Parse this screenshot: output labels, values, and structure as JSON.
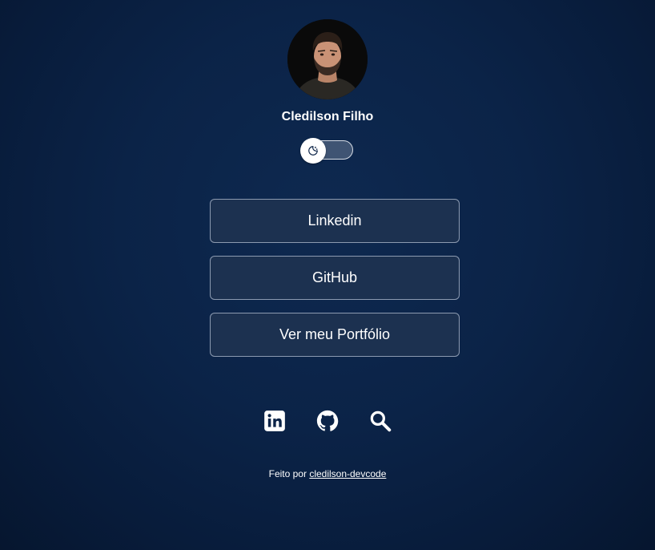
{
  "profile": {
    "name": "Cledilson Filho"
  },
  "theme_toggle": {
    "icon": "moon-sun-icon",
    "track_color": "#3f5473"
  },
  "links": [
    {
      "label": "Linkedin"
    },
    {
      "label": "GitHub"
    },
    {
      "label": "Ver meu Portfólio"
    }
  ],
  "socials": [
    {
      "icon": "linkedin-icon"
    },
    {
      "icon": "github-icon"
    },
    {
      "icon": "search-icon"
    }
  ],
  "footer": {
    "prefix": "Feito por",
    "author_link": "cledilson-devcode"
  },
  "colors": {
    "background": "#0b2347",
    "button_bg": "#1c3150",
    "button_border": "#8c9ab0",
    "text": "#ffffff"
  }
}
